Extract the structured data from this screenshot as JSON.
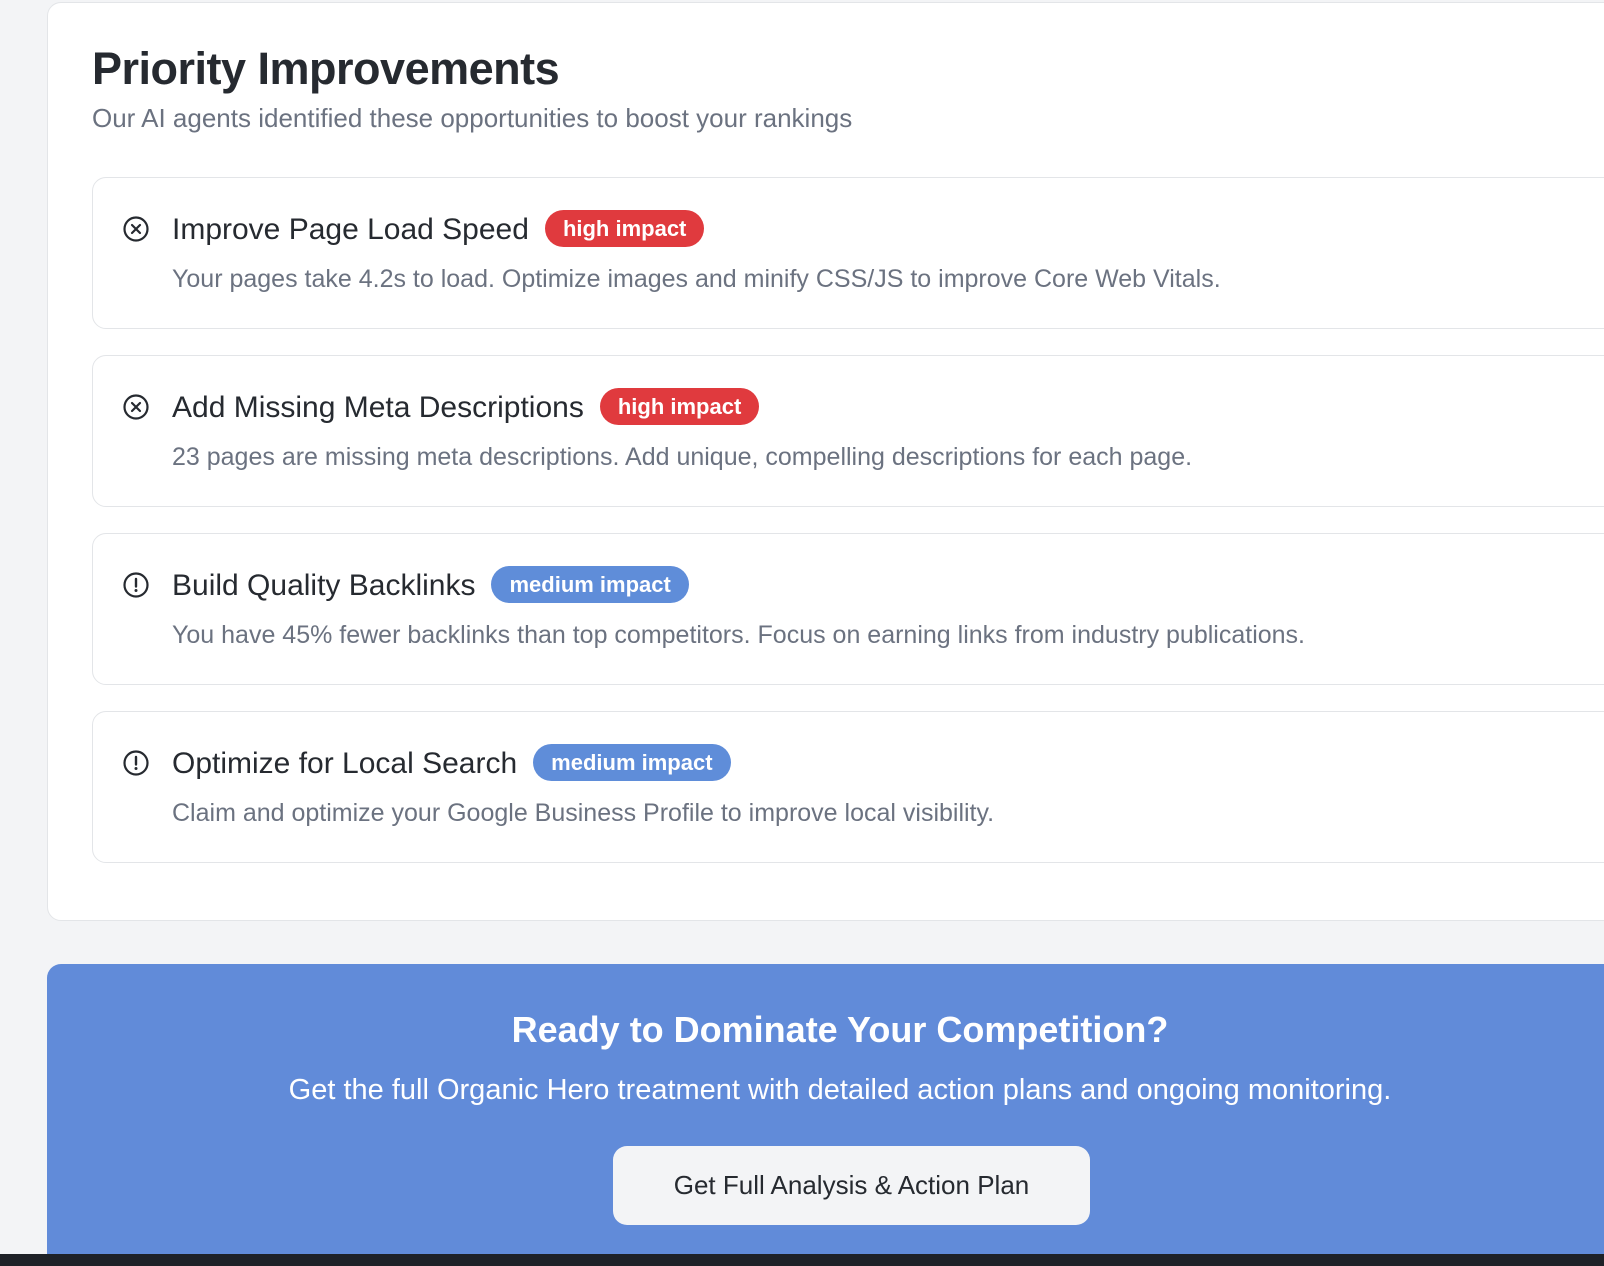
{
  "priority": {
    "title": "Priority Improvements",
    "subtitle": "Our AI agents identified these opportunities to boost your rankings",
    "items": [
      {
        "icon": "x-circle-icon",
        "title": "Improve Page Load Speed",
        "badge": "high impact",
        "badge_level": "high",
        "description": "Your pages take 4.2s to load. Optimize images and minify CSS/JS to improve Core Web Vitals."
      },
      {
        "icon": "x-circle-icon",
        "title": "Add Missing Meta Descriptions",
        "badge": "high impact",
        "badge_level": "high",
        "description": "23 pages are missing meta descriptions. Add unique, compelling descriptions for each page."
      },
      {
        "icon": "alert-circle-icon",
        "title": "Build Quality Backlinks",
        "badge": "medium impact",
        "badge_level": "medium",
        "description": "You have 45% fewer backlinks than top competitors. Focus on earning links from industry publications."
      },
      {
        "icon": "alert-circle-icon",
        "title": "Optimize for Local Search",
        "badge": "medium impact",
        "badge_level": "medium",
        "description": "Claim and optimize your Google Business Profile to improve local visibility."
      }
    ]
  },
  "cta": {
    "title": "Ready to Dominate Your Competition?",
    "text": "Get the full Organic Hero treatment with detailed action plans and ongoing monitoring.",
    "button_label": "Get Full Analysis & Action Plan"
  },
  "colors": {
    "high_badge": "#e03a3e",
    "medium_badge": "#5f8dd9",
    "cta_background": "#618bd9",
    "muted_text": "#6b7280",
    "heading_text": "#262a30"
  }
}
